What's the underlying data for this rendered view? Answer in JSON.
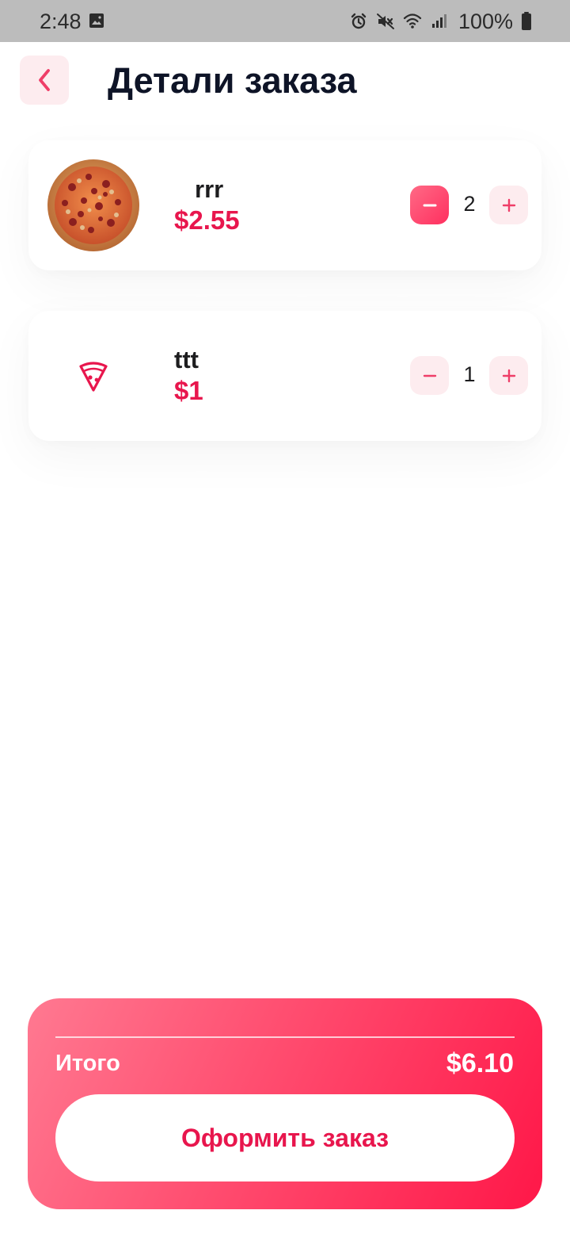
{
  "status_bar": {
    "time": "2:48",
    "battery": "100%",
    "icons": [
      "gallery-icon",
      "alarm-icon",
      "mute-icon",
      "wifi-icon",
      "signal-icon",
      "battery-icon"
    ]
  },
  "header": {
    "back_icon": "chevron-left-icon",
    "title": "Детали заказа"
  },
  "items": [
    {
      "name": "rrr",
      "price": "$2.55",
      "quantity": "2",
      "image": "pizza-photo",
      "minus_icon": "minus-icon",
      "plus_icon": "plus-icon"
    },
    {
      "name": "ttt",
      "price": "$1",
      "quantity": "1",
      "image": "pizza-slice-icon",
      "minus_icon": "minus-icon",
      "plus_icon": "plus-icon"
    }
  ],
  "summary": {
    "total_label": "Итого",
    "total_value": "$6.10",
    "checkout_label": "Оформить заказ"
  },
  "colors": {
    "accent": "#e8164d",
    "accent_soft": "#fdecef",
    "gradient_start": "#ff7991",
    "gradient_end": "#ff1748",
    "title": "#0e1427",
    "status_bar": "#bcbcbc"
  }
}
